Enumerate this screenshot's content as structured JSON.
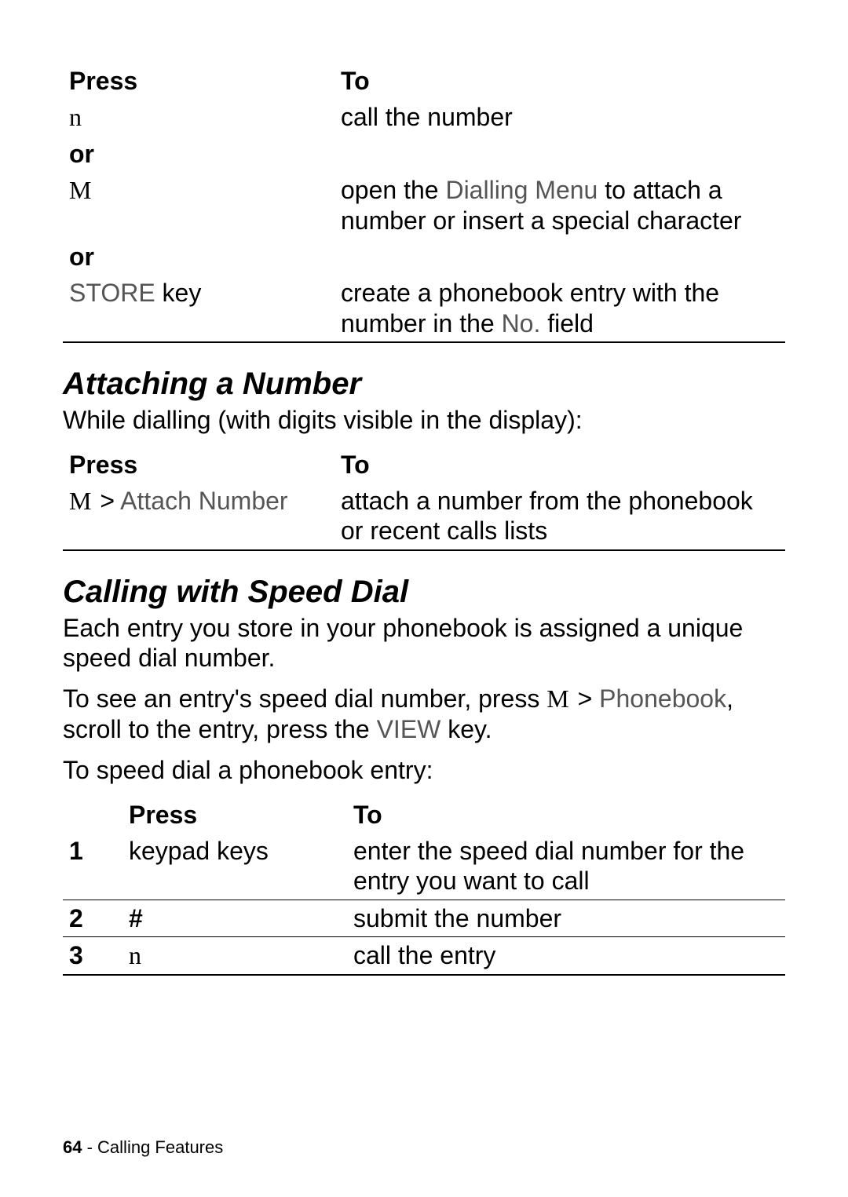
{
  "table1": {
    "headers": {
      "press": "Press",
      "to": "To"
    },
    "row_n": {
      "key": "n",
      "to": "call the number"
    },
    "or1": "or",
    "row_m": {
      "key": "M",
      "to_a": "open the ",
      "to_b": "Dialling Menu",
      "to_c": " to attach a number or insert a special character"
    },
    "or2": "or",
    "row_store": {
      "key_a": "STORE",
      "key_b": " key",
      "to_a": "create a phonebook entry with the number in the ",
      "to_b": "No.",
      "to_c": " field"
    }
  },
  "section1": {
    "title": "Attaching a Number",
    "intro": "While dialling (with digits visible in the display):"
  },
  "table2": {
    "headers": {
      "press": "Press",
      "to": "To"
    },
    "row": {
      "key_a": "M",
      "key_b": "> ",
      "key_c": "Attach Number",
      "to": "attach a number from the phonebook or recent calls lists"
    }
  },
  "section2": {
    "title": "Calling with Speed Dial",
    "p1": "Each entry you store in your phonebook is assigned a unique speed dial number.",
    "p2_a": "To see an entry's speed dial number, press ",
    "p2_b": "M",
    "p2_c": " > ",
    "p2_d": "Phonebook",
    "p2_e": ", scroll to the entry, press the ",
    "p2_f": "VIEW",
    "p2_g": " key.",
    "p3": "To speed dial a phonebook entry:"
  },
  "table3": {
    "headers": {
      "press": "Press",
      "to": "To"
    },
    "r1": {
      "n": "1",
      "press": "keypad keys",
      "to": "enter the speed dial number for the entry you want to call"
    },
    "r2": {
      "n": "2",
      "press": "#",
      "to": "submit the number"
    },
    "r3": {
      "n": "3",
      "press": "n",
      "to": "call the entry"
    }
  },
  "footer": {
    "page": "64",
    "sep": " - ",
    "section": "Calling Features"
  }
}
